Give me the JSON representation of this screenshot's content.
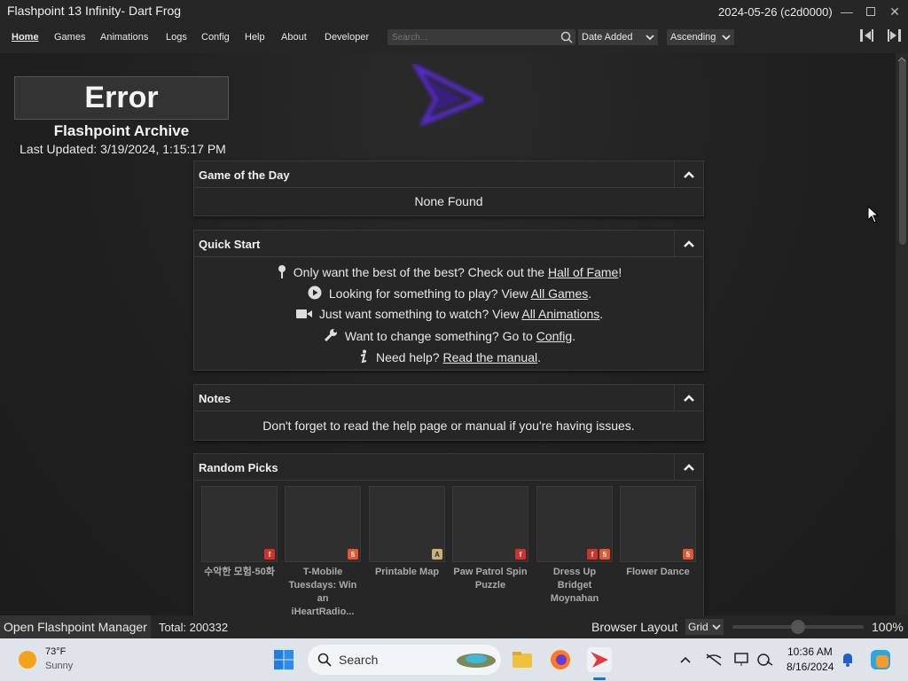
{
  "window": {
    "title": "Flashpoint 13 Infinity- Dart Frog",
    "version": "2024-05-26 (c2d0000)"
  },
  "menu": [
    "Home",
    "Games",
    "Animations",
    "Logs",
    "Config",
    "Help",
    "About",
    "Developer"
  ],
  "search": {
    "placeholder": "Search..."
  },
  "sort": {
    "field": "Date Added",
    "order": "Ascending"
  },
  "header": {
    "error": "Error",
    "archive": "Flashpoint Archive",
    "last_updated": "Last Updated: 3/19/2024, 1:15:17 PM"
  },
  "panels": {
    "gotd": {
      "title": "Game of the Day",
      "body": "None Found"
    },
    "quick": {
      "title": "Quick Start",
      "items": [
        {
          "pre": "Only want the best of the best? Check out the ",
          "link": "Hall of Fame",
          "post": "!",
          "icon": "medal-icon"
        },
        {
          "pre": "Looking for something to play? View ",
          "link": "All Games",
          "post": ".",
          "icon": "play-icon"
        },
        {
          "pre": "Just want something to watch? View ",
          "link": "All Animations",
          "post": ".",
          "icon": "video-icon"
        },
        {
          "pre": "Want to change something? Go to ",
          "link": "Config",
          "post": ".",
          "icon": "wrench-icon"
        },
        {
          "pre": "Need help? ",
          "link": "Read the manual",
          "post": ".",
          "icon": "info-icon"
        }
      ]
    },
    "notes": {
      "title": "Notes",
      "body": "Don't forget to read the help page or manual if you're having issues."
    },
    "random": {
      "title": "Random Picks",
      "picks": [
        {
          "name1": "수악한 모험-50화",
          "name2": "",
          "name3": "",
          "badges": [
            "flash"
          ]
        },
        {
          "name1": "T-Mobile",
          "name2": "Tuesdays: Win an",
          "name3": "iHeartRadio...",
          "badges": [
            "html5"
          ]
        },
        {
          "name1": "Printable Map",
          "name2": "",
          "name3": "",
          "badges": [
            "other"
          ]
        },
        {
          "name1": "Paw Patrol Spin",
          "name2": "Puzzle",
          "name3": "",
          "badges": [
            "flash"
          ]
        },
        {
          "name1": "Dress Up Bridget",
          "name2": "Moynahan",
          "name3": "",
          "badges": [
            "flash",
            "html5"
          ]
        },
        {
          "name1": "Flower Dance",
          "name2": "",
          "name3": "",
          "badges": [
            "html5"
          ]
        }
      ]
    }
  },
  "status": {
    "manager": "Open Flashpoint Manager",
    "total": "Total: 200332",
    "layout_label": "Browser Layout",
    "layout_value": "Grid",
    "zoom": "100%"
  },
  "taskbar": {
    "temp": "73°F",
    "weather": "Sunny",
    "search": "Search",
    "time": "10:36 AM",
    "date": "8/16/2024"
  },
  "colors": {
    "accent": "#6a2ad8",
    "flash": "#d0312d",
    "html5": "#e4572e"
  }
}
